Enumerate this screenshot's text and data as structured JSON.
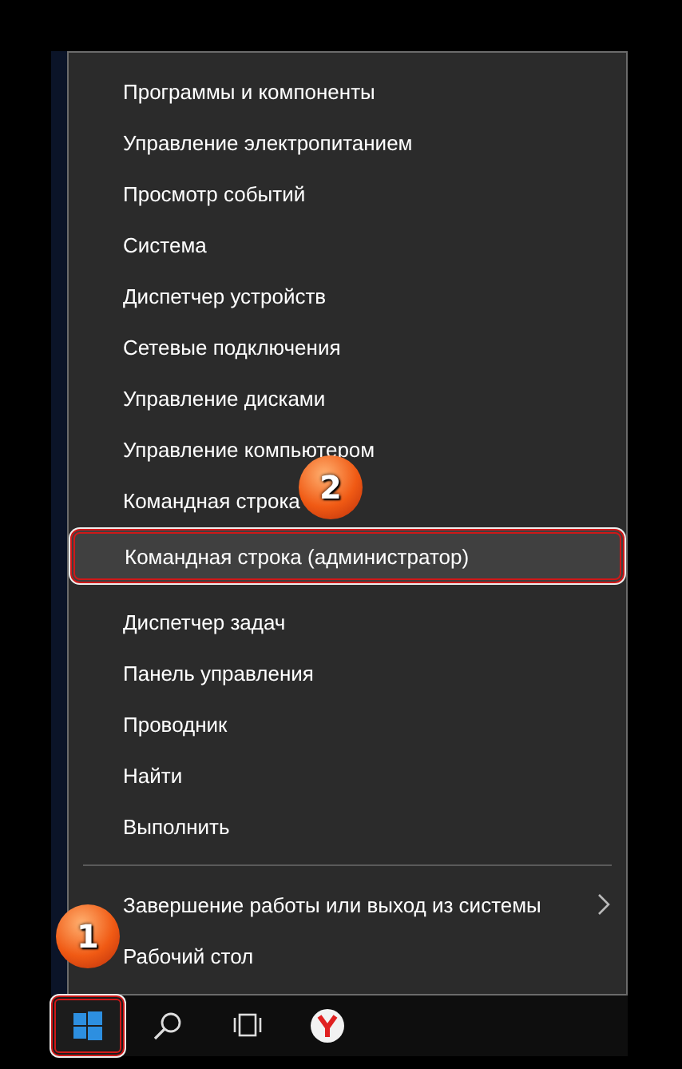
{
  "menu": {
    "step_badge": "2",
    "items": [
      {
        "label": "Программы и компоненты",
        "highlighted": false,
        "divider_before": false,
        "has_submenu": false
      },
      {
        "label": "Управление электропитанием",
        "highlighted": false,
        "divider_before": false,
        "has_submenu": false
      },
      {
        "label": "Просмотр событий",
        "highlighted": false,
        "divider_before": false,
        "has_submenu": false
      },
      {
        "label": "Система",
        "highlighted": false,
        "divider_before": false,
        "has_submenu": false
      },
      {
        "label": "Диспетчер устройств",
        "highlighted": false,
        "divider_before": false,
        "has_submenu": false
      },
      {
        "label": "Сетевые подключения",
        "highlighted": false,
        "divider_before": false,
        "has_submenu": false
      },
      {
        "label": "Управление дисками",
        "highlighted": false,
        "divider_before": false,
        "has_submenu": false
      },
      {
        "label": "Управление компьютером",
        "highlighted": false,
        "divider_before": false,
        "has_submenu": false
      },
      {
        "label": "Командная строка",
        "highlighted": false,
        "divider_before": false,
        "has_submenu": false
      },
      {
        "label": "Командная строка (администратор)",
        "highlighted": true,
        "divider_before": false,
        "has_submenu": false
      },
      {
        "label": "Диспетчер задач",
        "highlighted": false,
        "divider_before": false,
        "has_submenu": false
      },
      {
        "label": "Панель управления",
        "highlighted": false,
        "divider_before": false,
        "has_submenu": false
      },
      {
        "label": "Проводник",
        "highlighted": false,
        "divider_before": false,
        "has_submenu": false
      },
      {
        "label": "Найти",
        "highlighted": false,
        "divider_before": false,
        "has_submenu": false
      },
      {
        "label": "Выполнить",
        "highlighted": false,
        "divider_before": false,
        "has_submenu": false
      },
      {
        "label": "Завершение работы или выход из системы",
        "highlighted": false,
        "divider_before": true,
        "has_submenu": true
      },
      {
        "label": "Рабочий стол",
        "highlighted": false,
        "divider_before": false,
        "has_submenu": false
      }
    ]
  },
  "taskbar": {
    "step_badge": "1",
    "buttons": [
      {
        "kind": "start",
        "highlighted": true
      },
      {
        "kind": "search",
        "highlighted": false
      },
      {
        "kind": "taskview",
        "highlighted": false
      },
      {
        "kind": "browser",
        "highlighted": false
      }
    ]
  }
}
